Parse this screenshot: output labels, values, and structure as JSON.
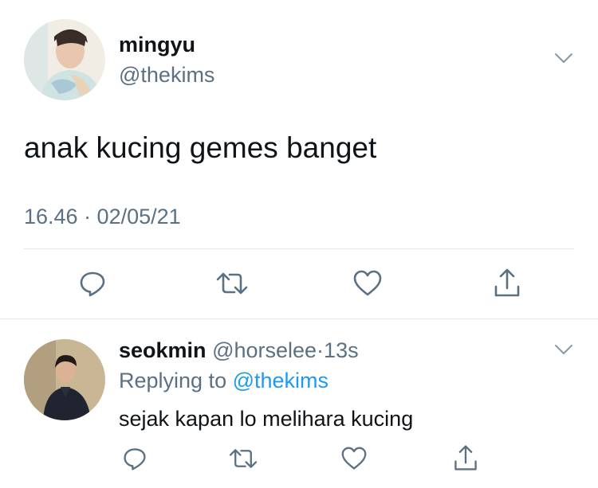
{
  "tweet": {
    "author_name": "mingyu",
    "author_handle": "@thekims",
    "text": "anak kucing gemes banget",
    "timestamp": "16.46 · 02/05/21",
    "actions": [
      "reply-icon",
      "retweet-icon",
      "like-icon",
      "share-icon"
    ]
  },
  "reply": {
    "author_name": "seokmin",
    "author_handle": "@horselee",
    "separator": "·",
    "time_ago": "13s",
    "replying_to_prefix": "Replying to",
    "replying_to_handle": "@thekims",
    "text": "sejak kapan lo melihara kucing",
    "actions": [
      "reply-icon",
      "retweet-icon",
      "like-icon",
      "share-icon"
    ]
  },
  "colors": {
    "text": "#0f1419",
    "secondary": "#5b7083",
    "link": "#1d9bf0",
    "divider": "#e1e8ed"
  }
}
